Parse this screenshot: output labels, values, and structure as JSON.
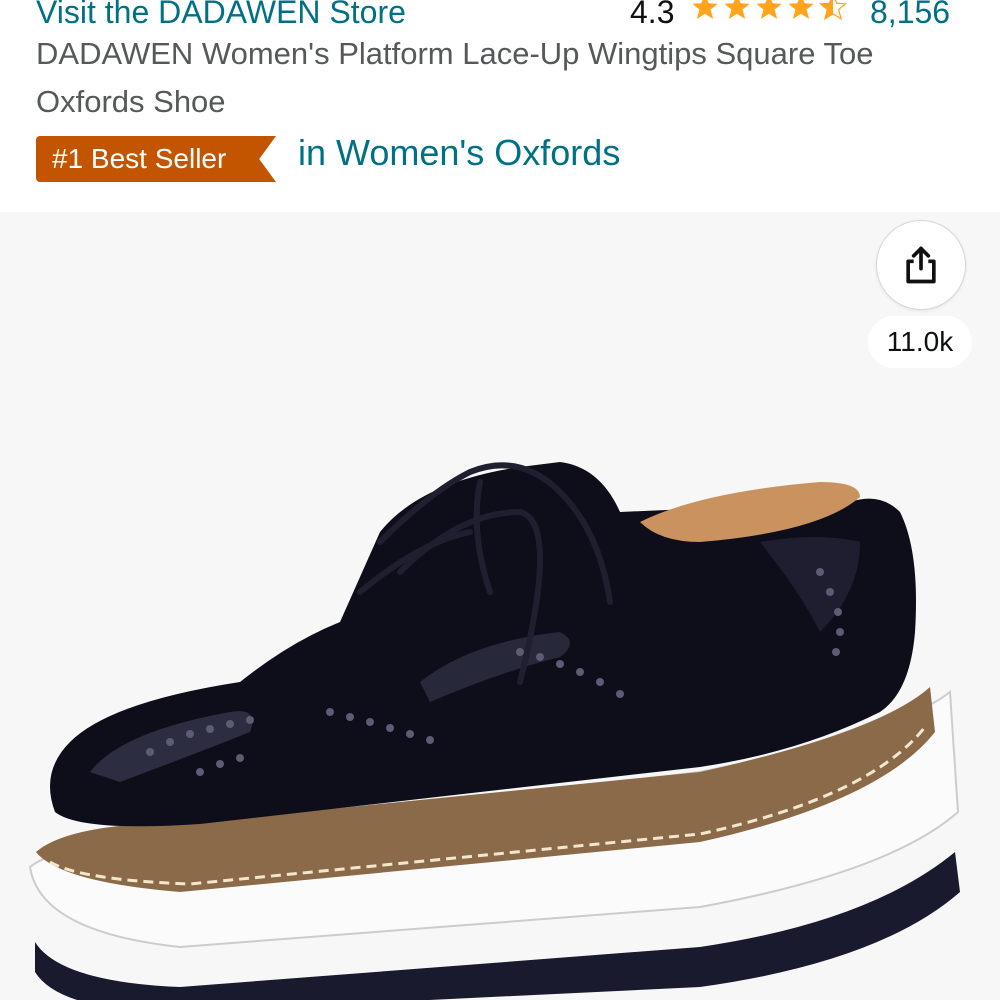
{
  "header": {
    "store_link": "Visit the DADAWEN Store",
    "rating": "4.3",
    "rating_value": 4.3,
    "review_count": "8,156"
  },
  "product": {
    "title": "DADAWEN Women's Platform Lace-Up Wingtips Square Toe Oxfords Shoe",
    "badge_label": "#1 Best Seller",
    "badge_category": "in Women's Oxfords"
  },
  "image": {
    "share_icon": "share-icon",
    "share_count": "11.0k"
  },
  "colors": {
    "link": "#007185",
    "star": "#ffa41c",
    "badge": "#c45500",
    "text_secondary": "#565959"
  }
}
